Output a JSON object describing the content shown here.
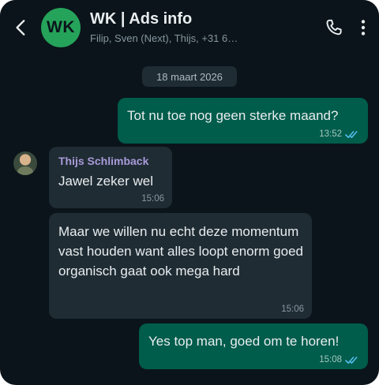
{
  "header": {
    "avatar_initials": "WK",
    "title": "WK | Ads info",
    "subtitle": "Filip, Sven (Next), Thijs, +31 6…",
    "icons": {
      "back": "back-icon",
      "call": "phone-icon",
      "menu": "more-options-icon"
    }
  },
  "date_chip": "18 maart 2026",
  "messages": [
    {
      "direction": "outgoing",
      "text": "Tot nu toe nog geen sterke maand?",
      "time": "13:52",
      "status": "read"
    },
    {
      "direction": "incoming",
      "sender": "Thijs Schlimback",
      "text": "Jawel zeker wel",
      "time": "15:06"
    },
    {
      "direction": "incoming",
      "text": "Maar we willen nu echt deze momentum vast houden want alles loopt enorm goed organisch gaat ook mega hard",
      "time": "15:06"
    },
    {
      "direction": "outgoing",
      "text": "Yes top man, goed om te horen!",
      "time": "15:08",
      "status": "read"
    }
  ],
  "colors": {
    "background": "#0b141a",
    "outgoing_bubble": "#005c4b",
    "incoming_bubble": "#1f2c34",
    "group_avatar": "#25a35a",
    "sender_name": "#a99ad8",
    "read_ticks": "#53bdeb"
  }
}
